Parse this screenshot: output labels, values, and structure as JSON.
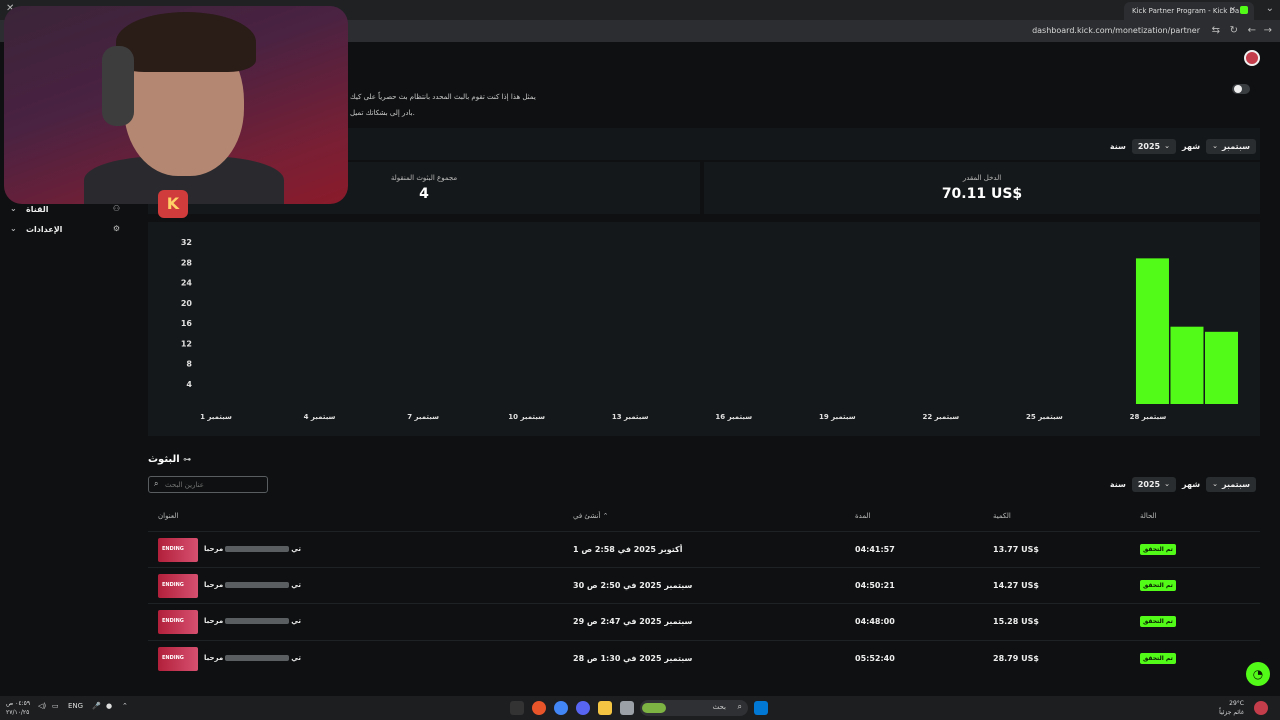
{
  "browser": {
    "tab_title": "Kick Partner Program - Kick Da",
    "url": "dashboard.kick.com/monetization/partner",
    "new_tab_icon": "+",
    "close_icon": "✕"
  },
  "notice": {
    "line1": "يمثل هذا إذا كنت تقوم بالبث المحدد بانتظام بث حصرياً على كيك",
    "line2": "بادر إلى بشكاتك تميل."
  },
  "filters": {
    "year_label": "سنة",
    "year_value": "2025",
    "month_label": "شهر",
    "month_value": "سبتمبر"
  },
  "sidebar": {
    "items": [
      {
        "label": "القناة",
        "icon": "channel-icon"
      },
      {
        "label": "الإعدادات",
        "icon": "gear-icon"
      }
    ]
  },
  "stats": {
    "streams_label": "مجموع البثوث المنقولة",
    "streams_value": "4",
    "income_label": "الدخل المقدر",
    "income_value": "70.11 US$"
  },
  "chart_data": {
    "type": "bar",
    "x_ticks": [
      "سبتمبر 1",
      "سبتمبر 4",
      "سبتمبر 7",
      "سبتمبر 10",
      "سبتمبر 13",
      "سبتمبر 16",
      "سبتمبر 19",
      "سبتمبر 22",
      "سبتمبر 25",
      "سبتمبر 28"
    ],
    "x_tick_days": [
      1,
      4,
      7,
      10,
      13,
      16,
      19,
      22,
      25,
      28
    ],
    "y_ticks": [
      4,
      8,
      12,
      16,
      20,
      24,
      28,
      32
    ],
    "bars": [
      {
        "day": 28,
        "value": 28.79
      },
      {
        "day": 29,
        "value": 15.28
      },
      {
        "day": 30,
        "value": 14.27
      }
    ],
    "ylim": [
      0,
      34
    ],
    "xlim": [
      1,
      30
    ],
    "bar_color": "#53fc18"
  },
  "videos": {
    "title": "البثوث",
    "search_placeholder": "عنارين البحث",
    "columns": {
      "title": "العنوان",
      "published": "أنشئ في",
      "duration": "المدة",
      "amount": "الكمية",
      "status": "الحالة"
    },
    "rows": [
      {
        "title_start": "مرحبا",
        "title_end": "تي",
        "thumb": "ENDING",
        "date": "أكتوبر 2025 في 2:58 ص 1",
        "duration": "04:41:57",
        "amount": "13.77 US$",
        "status": "تم التحقق"
      },
      {
        "title_start": "مرحبا",
        "title_end": "تي",
        "thumb": "ENDING",
        "date": "سبتمبر 2025 في 2:50 ص 30",
        "duration": "04:50:21",
        "amount": "14.27 US$",
        "status": "تم التحقق"
      },
      {
        "title_start": "مرحبا",
        "title_end": "تي",
        "thumb": "ENDING",
        "date": "سبتمبر 2025 في 2:47 ص 29",
        "duration": "04:48:00",
        "amount": "15.28 US$",
        "status": "تم التحقق"
      },
      {
        "title_start": "مرحبا",
        "title_end": "تي",
        "thumb": "ENDING",
        "date": "سبتمبر 2025 في 1:30 ص 28",
        "duration": "05:52:40",
        "amount": "28.79 US$",
        "status": "تم التحقق"
      }
    ]
  },
  "taskbar": {
    "lang": "ENG",
    "search_placeholder": "بحث",
    "weather_temp": "29°C",
    "weather_desc": "غائم جزئياً",
    "clock_time": "٠٤:٥٩ ص",
    "clock_date": "٢٧/١٠/٢٥"
  }
}
